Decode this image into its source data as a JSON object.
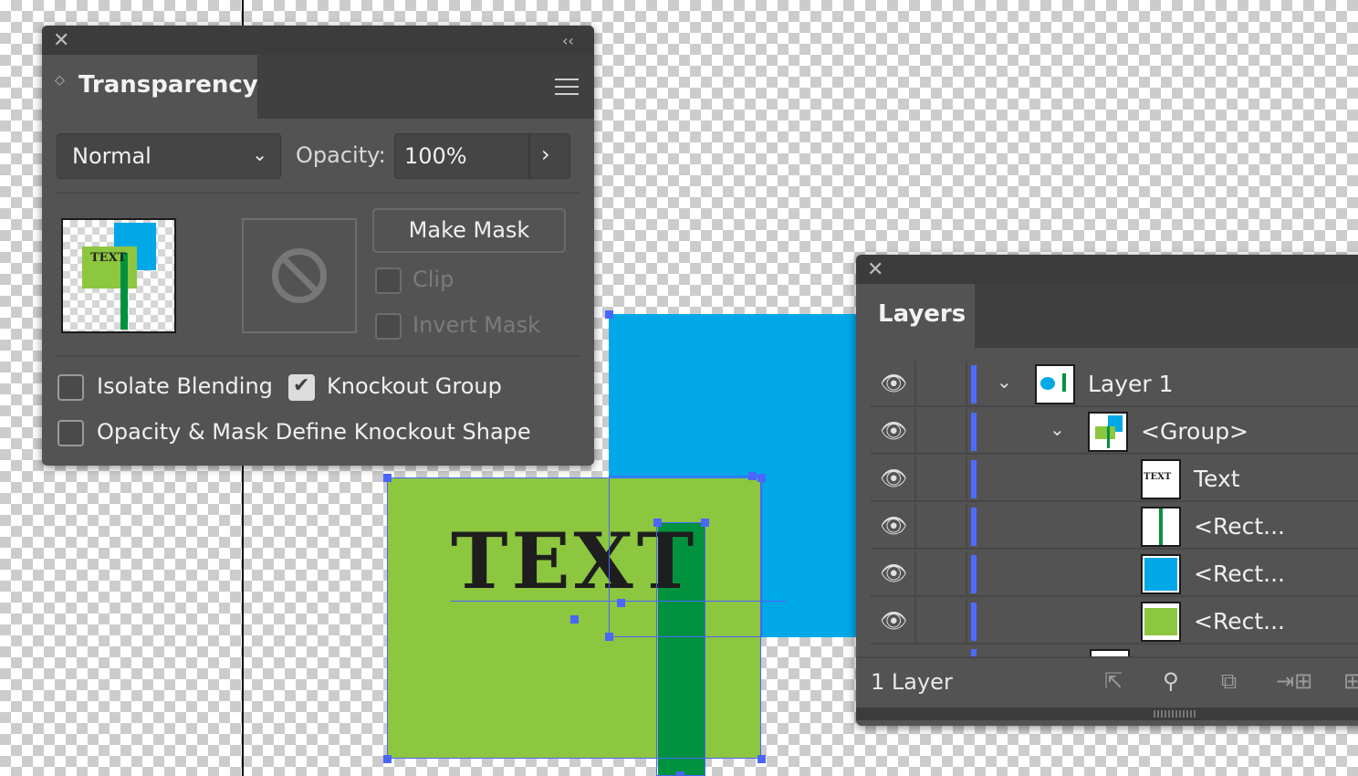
{
  "canvas": {
    "art_text": "TEXT",
    "colors": {
      "blue": "#00a8e8",
      "green": "#8dc63f",
      "dark_green": "#00923f",
      "selection": "#4a66ff"
    }
  },
  "transparency_panel": {
    "tab_title": "Transparency",
    "blend_mode": "Normal",
    "opacity_label": "Opacity:",
    "opacity_value": "100%",
    "thumb_text": "TEXT",
    "make_mask_label": "Make Mask",
    "clip_label": "Clip",
    "invert_mask_label": "Invert Mask",
    "isolate_blending_label": "Isolate Blending",
    "knockout_group_label": "Knockout Group",
    "opacity_mask_knockout_label": "Opacity & Mask Define Knockout Shape",
    "checks": {
      "clip": false,
      "invert_mask": false,
      "isolate_blending": false,
      "knockout_group": true,
      "opacity_mask_knockout": false
    }
  },
  "layers_panel": {
    "tab_title": "Layers",
    "rows": [
      {
        "label": "Layer 1",
        "thumb": "layer-thumbnail",
        "expanded": true
      },
      {
        "label": "<Group>",
        "thumb": "group-thumbnail",
        "expanded": true
      },
      {
        "label": "Text",
        "thumb": "text-thumbnail",
        "thumb_text": "TEXT"
      },
      {
        "label": "<Rect...",
        "thumb": "dark-green-rect-thumbnail"
      },
      {
        "label": "<Rect...",
        "thumb": "blue-rect-thumbnail"
      },
      {
        "label": "<Rect...",
        "thumb": "green-rect-thumbnail"
      }
    ],
    "footer_count": "1 Layer"
  }
}
